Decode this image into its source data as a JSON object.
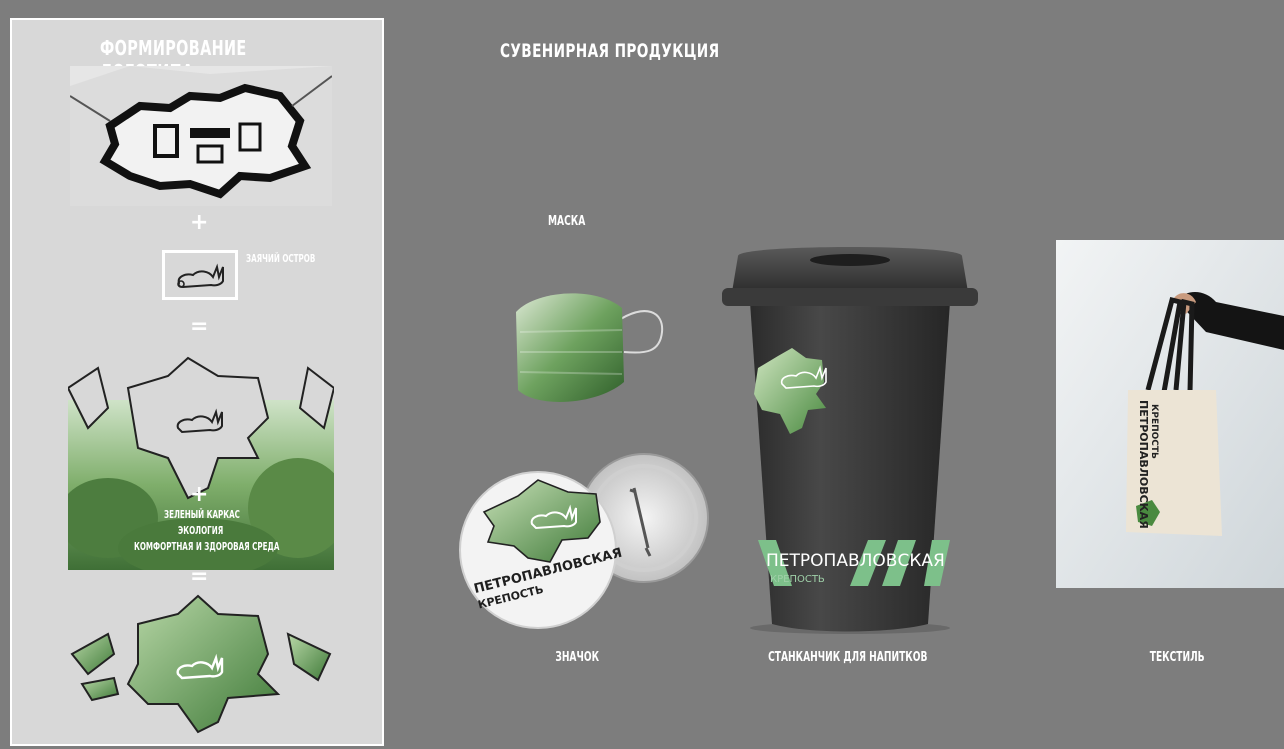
{
  "left_panel": {
    "title": "ФОРМИРОВАНИЕ ЛОГОТИПА",
    "island_label": "ЗАЯЧИЙ ОСТРОВ",
    "plus_sign": "+",
    "equals_sign": "=",
    "green_concepts": [
      "ЗЕЛЕНЫЙ КАРКАС",
      "ЭКОЛОГИЯ",
      "КОМФОРТНАЯ И ЗДОРОВАЯ СРЕДА"
    ]
  },
  "main": {
    "title": "СУВЕНИРНАЯ ПРОДУКЦИЯ",
    "products": [
      {
        "id": "mask",
        "label": "МАСКА"
      },
      {
        "id": "badge",
        "label": "ЗНАЧОК"
      },
      {
        "id": "cup",
        "label": "СТАНКАНЧИК ДЛЯ НАПИТКОВ"
      },
      {
        "id": "textile",
        "label": "ТЕКСТИЛЬ"
      }
    ],
    "brand": {
      "line1": "ПЕТРОПАВЛОВСКАЯ",
      "line2": "КРЕПОСТЬ"
    }
  },
  "colors": {
    "background": "#7d7d7d",
    "panel": "#d8d8d8",
    "accent_green": "#6ab07a",
    "cup_black": "#3a3a3a"
  }
}
